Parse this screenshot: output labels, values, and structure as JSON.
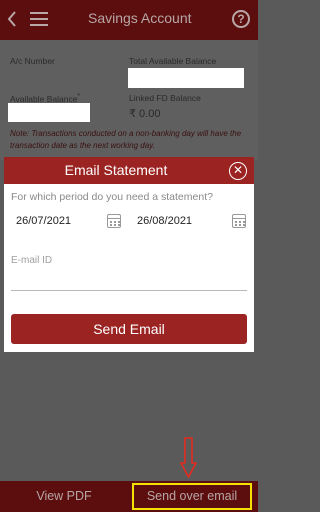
{
  "header": {
    "title": "Savings Account",
    "help": "?"
  },
  "account": {
    "ac_number_label": "A/c Number",
    "total_balance_label": "Total Available Balance",
    "available_balance_label": "Available Balance",
    "available_balance_mark": "*",
    "linked_fd_label": "Linked FD Balance",
    "linked_fd_value": "₹ 0.00",
    "note": "Note: Transactions conducted on a non-banking day will have the transaction date as the next working day."
  },
  "dialog": {
    "title": "Email Statement",
    "close": "✕",
    "question": "For which period do you need a statement?",
    "from_date": "26/07/2021",
    "to_date": "26/08/2021",
    "email_placeholder": "E-mail ID",
    "send_label": "Send Email"
  },
  "bottom_bar": {
    "view_pdf": "View PDF",
    "send_over_email": "Send over email"
  },
  "colors": {
    "accent": "#9b2322",
    "highlight": "#f5e100",
    "arrow": "#e52b1f"
  }
}
